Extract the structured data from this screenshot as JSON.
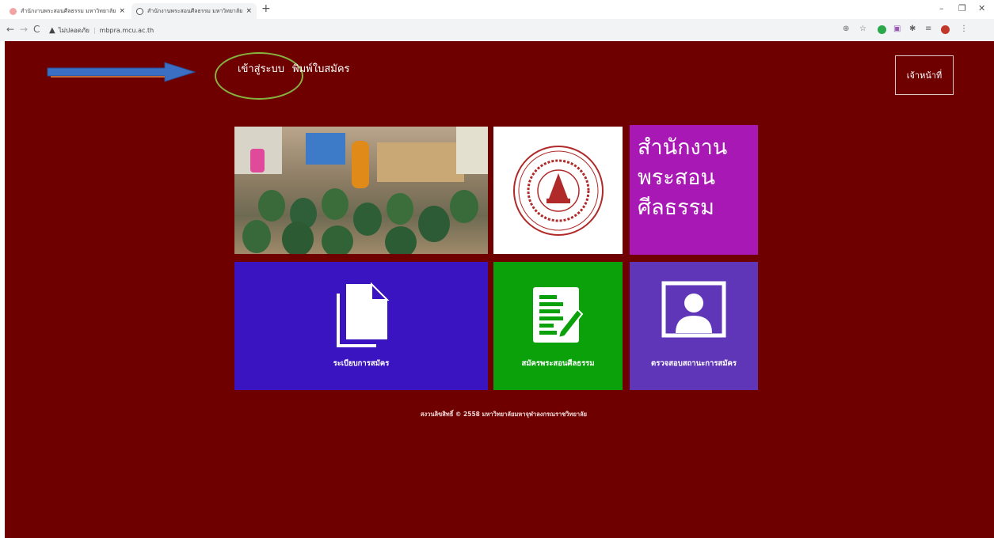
{
  "browser": {
    "tabs": [
      {
        "title": "สำนักงานพระสอนศีลธรรม มหาวิทยาลัยฯ",
        "close": "×"
      },
      {
        "title": "สำนักงานพระสอนศีลธรรม มหาวิทยาลัยฯ",
        "close": "×"
      }
    ],
    "new_tab": "+",
    "window_controls": {
      "minimize": "–",
      "maximize": "❐",
      "close": "✕"
    },
    "nav": {
      "back": "←",
      "forward": "→",
      "reload": "C"
    },
    "address": {
      "security_label": "ไม่ปลอดภัย",
      "url": "mbpra.mcu.ac.th"
    }
  },
  "header": {
    "login_link": "เข้าสู่ระบบ",
    "print_link": "พิมพ์ใบสมัคร",
    "staff_button": "เจ้าหน้าที่"
  },
  "tiles": {
    "brand_lines": [
      "สำนักงาน",
      "พระสอน",
      "ศีลธรรม"
    ],
    "guide_label": "ระเบียบการสมัคร",
    "apply_label": "สมัครพระสอนศีลธรรม",
    "status_label": "ตรวจสอบสถานะการสมัคร"
  },
  "footer": {
    "copyright": "สงวนลิขสิทธิ์ © 2558 มหาวิทยาลัยมหาจุฬาลงกรณราชวิทยาลัย"
  },
  "colors": {
    "page_bg": "#6e0000",
    "brand_tile": "#a818b4",
    "guide_tile": "#3a14c0",
    "apply_tile": "#0aa10a",
    "status_tile": "#5f36b8",
    "annotation_circle": "#86b23f",
    "annotation_arrow": "#3b6fc4"
  },
  "icons": {
    "document": "document-icon",
    "form_edit": "form-edit-icon",
    "user_portrait": "user-portrait-icon",
    "university_seal": "university-seal"
  }
}
